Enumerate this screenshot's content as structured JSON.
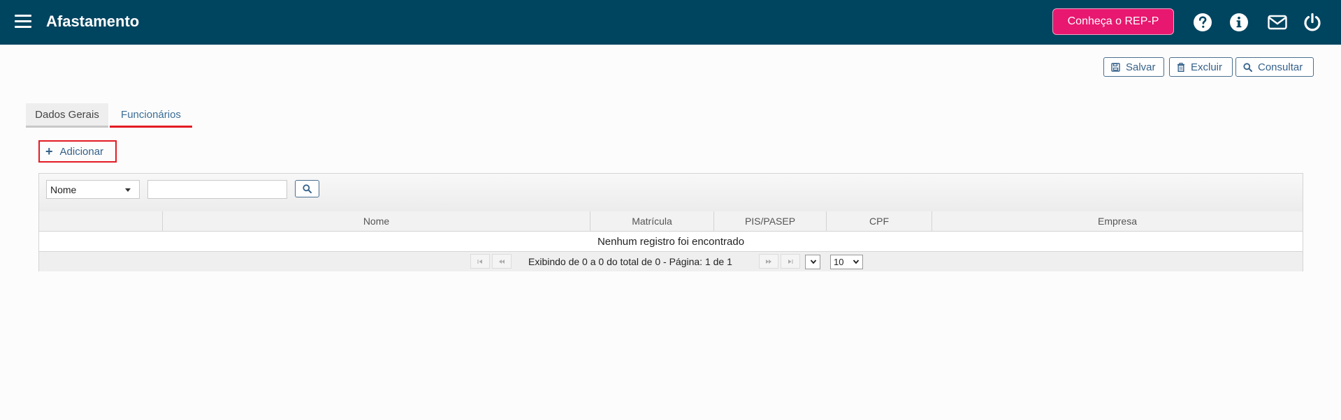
{
  "header": {
    "title": "Afastamento",
    "rep_button": "Conheça o REP-P",
    "icons": [
      "menu-icon",
      "help-icon",
      "info-icon",
      "mail-icon",
      "power-icon"
    ],
    "background": "#004560",
    "accent": "#e8176f"
  },
  "toolbar": {
    "save_label": "Salvar",
    "delete_label": "Excluir",
    "query_label": "Consultar"
  },
  "tabs": [
    {
      "label": "Dados Gerais",
      "active": false
    },
    {
      "label": "Funcionários",
      "active": true
    }
  ],
  "add_label": "Adicionar",
  "filter": {
    "field_value": "Nome",
    "search_value": ""
  },
  "table": {
    "columns": [
      "",
      "Nome",
      "Matrícula",
      "PIS/PASEP",
      "CPF",
      "Empresa"
    ],
    "empty_message": "Nenhum registro foi encontrado"
  },
  "paginator": {
    "summary": "Exibindo de 0 a 0 do total de 0 - Página: 1 de 1",
    "page_value": "",
    "rows_per_page": "10"
  }
}
